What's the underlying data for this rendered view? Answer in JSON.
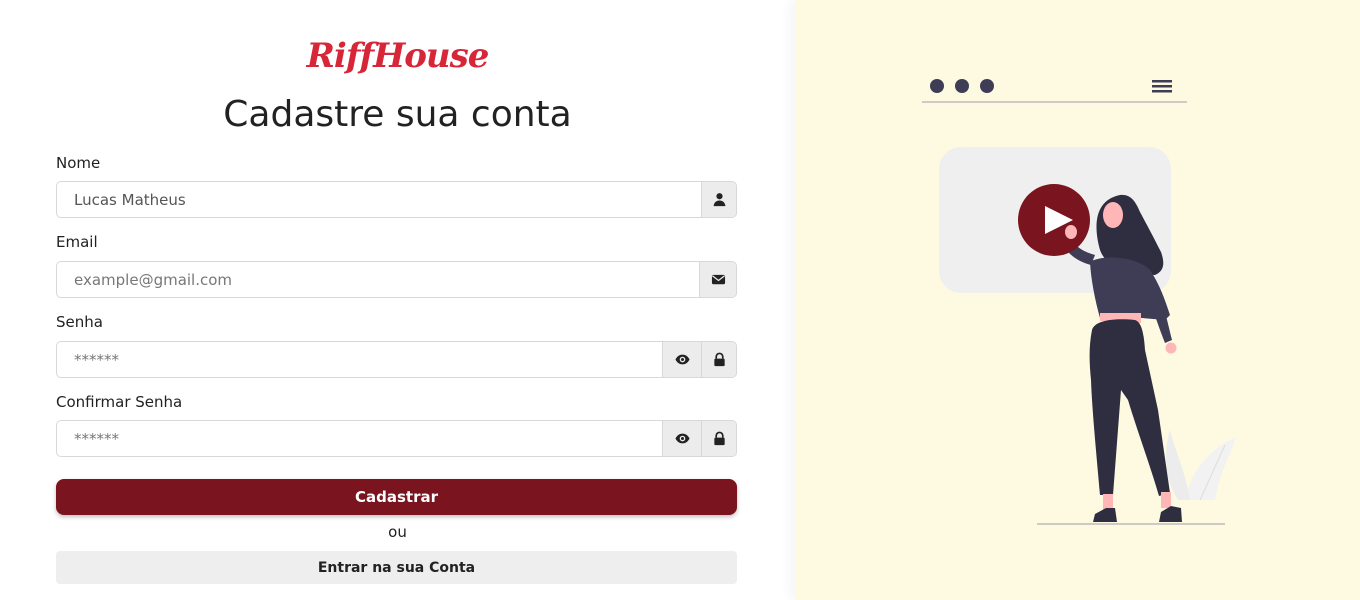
{
  "brand": {
    "logo": "RiffHouse"
  },
  "form": {
    "title": "Cadastre sua conta",
    "name": {
      "label": "Nome",
      "value": "Lucas Matheus"
    },
    "email": {
      "label": "Email",
      "placeholder": "example@gmail.com"
    },
    "password": {
      "label": "Senha",
      "placeholder": "******"
    },
    "confirm": {
      "label": "Confirmar Senha",
      "placeholder": "******"
    },
    "submit_label": "Cadastrar",
    "or_text": "ou",
    "login_label": "Entrar na sua Conta"
  },
  "colors": {
    "brand_red": "#d72638",
    "primary_button": "#7a141e",
    "illustration_bg": "#fef9e1"
  },
  "icons": [
    "user-icon",
    "envelope-icon",
    "eye-icon",
    "lock-icon",
    "hamburger-icon",
    "play-icon"
  ]
}
